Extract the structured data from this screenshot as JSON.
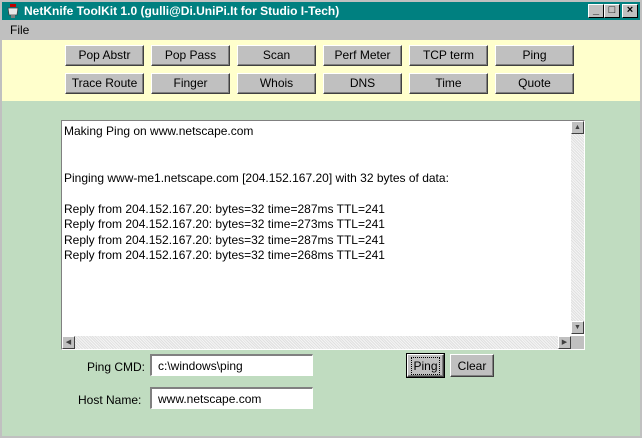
{
  "window": {
    "title": "NetKnife ToolKit 1.0 (gulli@Di.UniPi.It for Studio I-Tech)",
    "controls": {
      "minimize": "_",
      "maximize": "□",
      "close": "×"
    }
  },
  "menu": {
    "file": "File"
  },
  "toolbar": {
    "row1": [
      "Pop Abstr",
      "Pop Pass",
      "Scan",
      "Perf Meter",
      "TCP term",
      "Ping"
    ],
    "row2": [
      "Trace Route",
      "Finger",
      "Whois",
      "DNS",
      "Time",
      "Quote"
    ]
  },
  "output": {
    "lines": [
      "Making Ping on www.netscape.com",
      "",
      "",
      "Pinging www-me1.netscape.com [204.152.167.20] with 32 bytes of data:",
      "",
      "Reply from 204.152.167.20: bytes=32 time=287ms TTL=241",
      "Reply from 204.152.167.20: bytes=32 time=273ms TTL=241",
      "Reply from 204.152.167.20: bytes=32 time=287ms TTL=241",
      "Reply from 204.152.167.20: bytes=32 time=268ms TTL=241"
    ]
  },
  "form": {
    "ping_cmd_label": "Ping CMD:",
    "ping_cmd_value": "c:\\windows\\ping",
    "host_label": "Host Name:",
    "host_value": "www.netscape.com",
    "ping_button": "Ping",
    "clear_button": "Clear"
  },
  "colors": {
    "titlebar": "#008080",
    "toolbar_bg": "#ffffcc",
    "panel_bg": "#c0dcc0"
  }
}
